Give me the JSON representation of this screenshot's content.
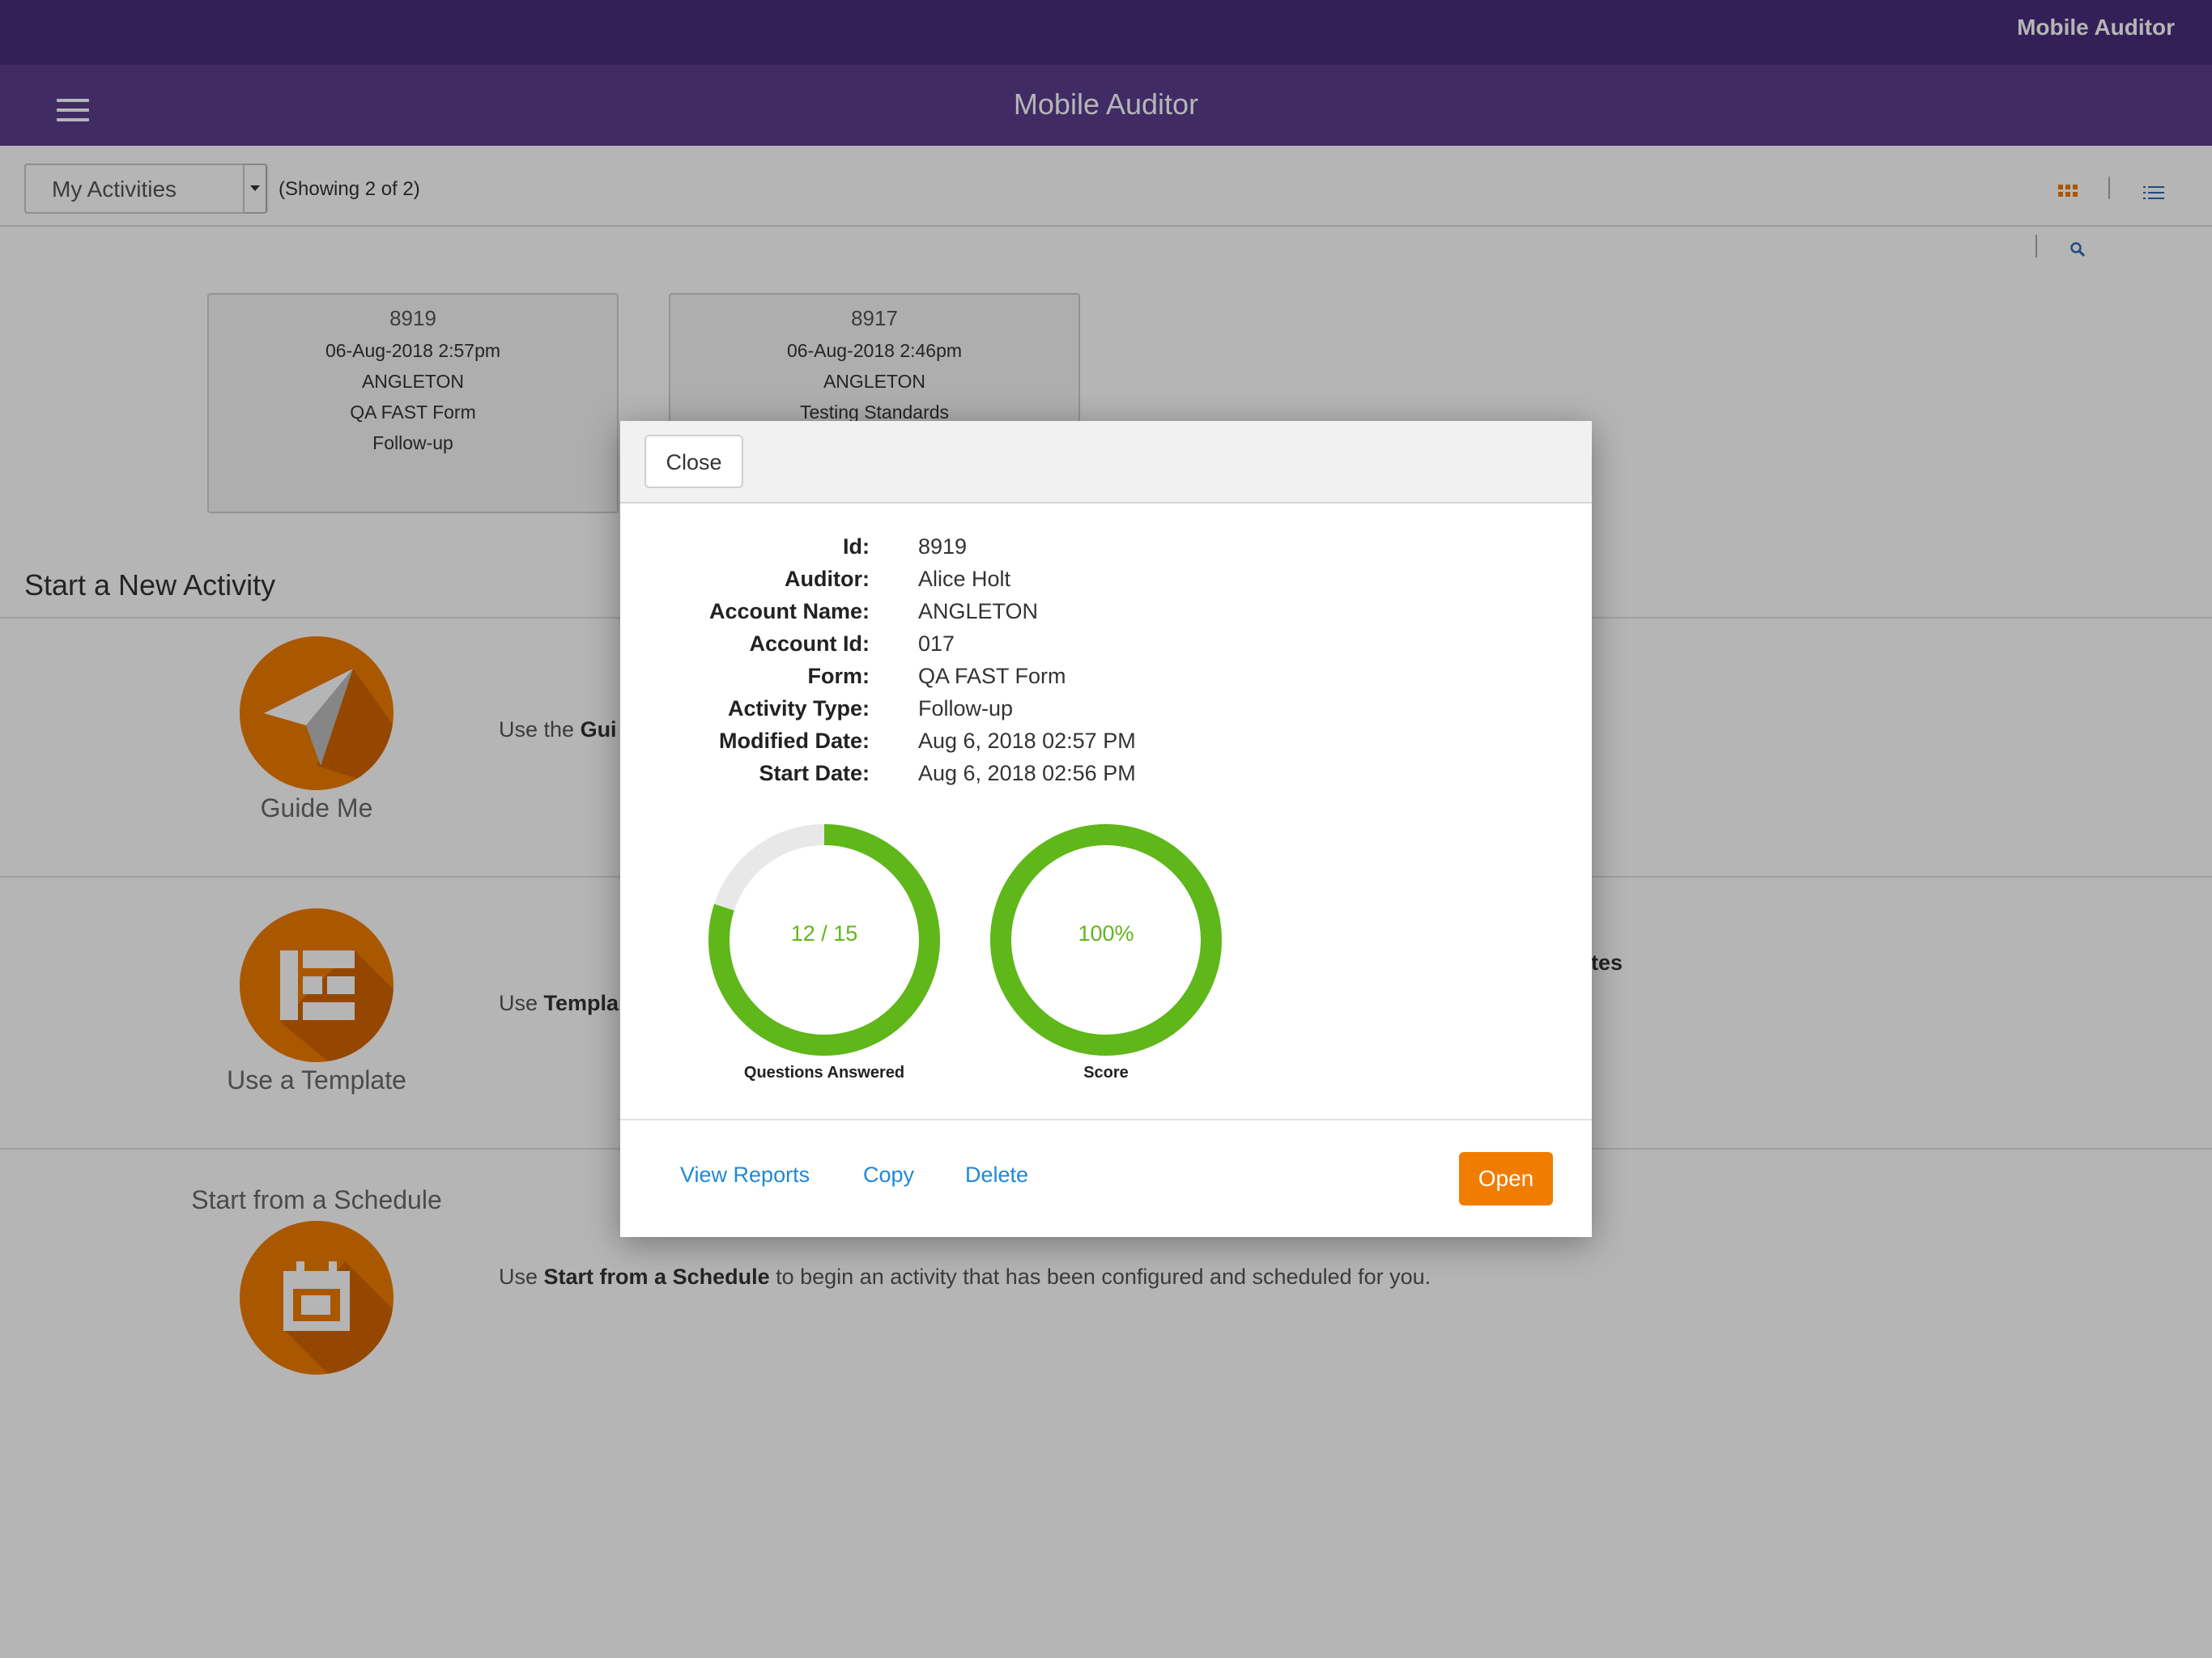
{
  "status_bar": {
    "title": "Mobile Auditor"
  },
  "nav": {
    "title": "Mobile Auditor"
  },
  "filter": {
    "selected": "My Activities",
    "showing": "(Showing 2 of 2)"
  },
  "cards": [
    {
      "id": "8919",
      "date": "06-Aug-2018 2:57pm",
      "account": "ANGLETON",
      "form": "QA FAST Form",
      "type": "Follow-up"
    },
    {
      "id": "8917",
      "date": "06-Aug-2018 2:46pm",
      "account": "ANGLETON",
      "form": "Testing Standards",
      "type": ""
    }
  ],
  "new_activity": {
    "title": "Start a New Activity",
    "options": [
      {
        "label": "Guide Me",
        "desc_prefix": "Use the ",
        "desc_bold": "Gui",
        "desc_suffix": ""
      },
      {
        "label": "Use a Template",
        "desc_prefix": "Use ",
        "desc_bold": "Templa",
        "desc_suffix": "",
        "desc_right": "ates"
      },
      {
        "label": "Start from a Schedule",
        "desc_prefix": "Use ",
        "desc_bold": "Start from a Schedule",
        "desc_suffix": " to begin an activity that has been configured and scheduled for you."
      }
    ]
  },
  "modal": {
    "close_label": "Close",
    "details": [
      {
        "label": "Id:",
        "value": "8919"
      },
      {
        "label": "Auditor:",
        "value": "Alice Holt"
      },
      {
        "label": "Account Name:",
        "value": "ANGLETON"
      },
      {
        "label": "Account Id:",
        "value": "017"
      },
      {
        "label": "Form:",
        "value": "QA FAST Form"
      },
      {
        "label": "Activity Type:",
        "value": "Follow-up"
      },
      {
        "label": "Modified Date:",
        "value": "Aug 6, 2018 02:57 PM"
      },
      {
        "label": "Start Date:",
        "value": "Aug 6, 2018 02:56 PM"
      }
    ],
    "gauges": [
      {
        "text": "12 / 15",
        "caption": "Questions Answered",
        "fraction": 0.8
      },
      {
        "text": "100%",
        "caption": "Score",
        "fraction": 1.0
      }
    ],
    "actions": {
      "view_reports": "View Reports",
      "copy": "Copy",
      "delete": "Delete",
      "open": "Open"
    }
  },
  "colors": {
    "accent": "#f07d00",
    "header": "#5b3d8e",
    "status": "#4a2e7c",
    "gauge_green": "#5fb71a",
    "gauge_track": "#e8e8e8",
    "link": "#1f88d8"
  }
}
